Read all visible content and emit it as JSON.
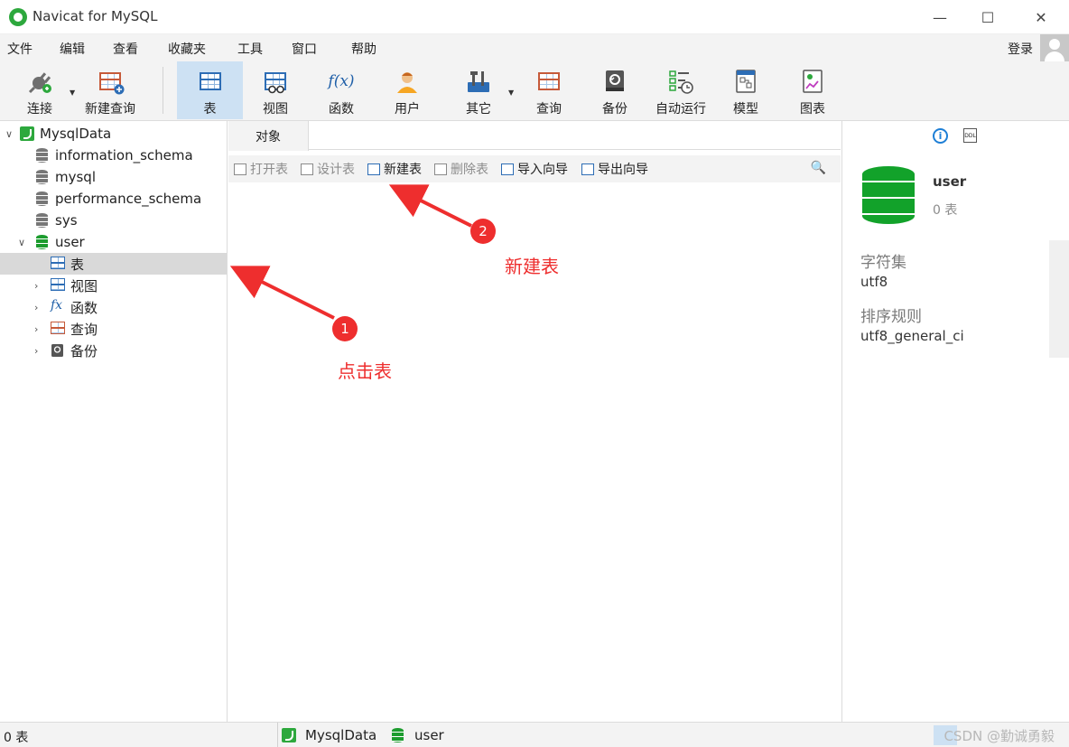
{
  "window": {
    "title": "Navicat for MySQL",
    "controls": {
      "minimize": "—",
      "maximize": "☐",
      "close": "✕"
    }
  },
  "menu": {
    "items": [
      "文件",
      "编辑",
      "查看",
      "收藏夹",
      "工具",
      "窗口",
      "帮助"
    ],
    "login": "登录"
  },
  "toolbar": {
    "buttons": [
      {
        "label": "连接",
        "icon": "plug-icon"
      },
      {
        "label": "新建查询",
        "icon": "new-query-icon"
      },
      {
        "label": "表",
        "icon": "table-icon",
        "active": true
      },
      {
        "label": "视图",
        "icon": "view-icon"
      },
      {
        "label": "函数",
        "icon": "function-icon",
        "glyph": "f(x)"
      },
      {
        "label": "用户",
        "icon": "user-icon"
      },
      {
        "label": "其它",
        "icon": "tools-icon"
      },
      {
        "label": "查询",
        "icon": "query-icon"
      },
      {
        "label": "备份",
        "icon": "backup-icon"
      },
      {
        "label": "自动运行",
        "icon": "schedule-icon"
      },
      {
        "label": "模型",
        "icon": "model-icon"
      },
      {
        "label": "图表",
        "icon": "chart-icon"
      }
    ]
  },
  "tree": {
    "connection": "MysqlData",
    "databases": [
      "information_schema",
      "mysql",
      "performance_schema",
      "sys",
      "user"
    ],
    "children": [
      {
        "label": "表",
        "icon": "table-icon",
        "selected": true
      },
      {
        "label": "视图",
        "icon": "view-icon"
      },
      {
        "label": "函数",
        "icon": "function-icon",
        "glyph": "fx"
      },
      {
        "label": "查询",
        "icon": "query-icon"
      },
      {
        "label": "备份",
        "icon": "backup-icon"
      }
    ]
  },
  "tabs": {
    "objects": "对象"
  },
  "object_toolbar": {
    "open_table": "打开表",
    "design_table": "设计表",
    "new_table": "新建表",
    "delete_table": "删除表",
    "import_wizard": "导入向导",
    "export_wizard": "导出向导",
    "search_icon": "🔍"
  },
  "info_panel": {
    "info_glyph": "i",
    "ddl_glyph": "DDL",
    "object_name": "user",
    "object_count": "0 表",
    "charset_label": "字符集",
    "charset_value": "utf8",
    "collation_label": "排序规则",
    "collation_value": "utf8_general_ci"
  },
  "status": {
    "count": "0 表",
    "connection": "MysqlData",
    "database": "user",
    "watermark": "CSDN @勤诚勇毅"
  },
  "annotations": {
    "step1_number": "1",
    "step1_text": "点击表",
    "step2_number": "2",
    "step2_text": "新建表",
    "color": "#ee2e2e"
  },
  "colors": {
    "active_tool": "#cde1f3",
    "selected_row": "#d9d9d9",
    "db_green": "#12a22a",
    "info_blue": "#1e7fd6"
  }
}
